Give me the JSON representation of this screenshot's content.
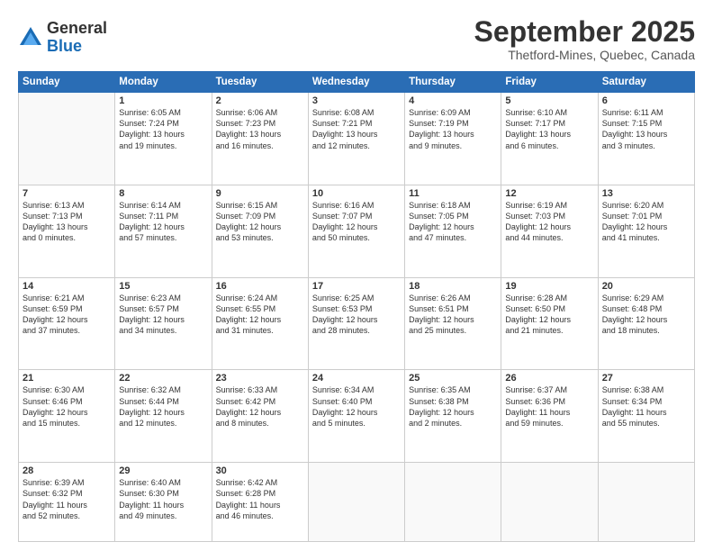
{
  "logo": {
    "general": "General",
    "blue": "Blue"
  },
  "header": {
    "month": "September 2025",
    "location": "Thetford-Mines, Quebec, Canada"
  },
  "weekdays": [
    "Sunday",
    "Monday",
    "Tuesday",
    "Wednesday",
    "Thursday",
    "Friday",
    "Saturday"
  ],
  "weeks": [
    [
      {
        "day": "",
        "info": ""
      },
      {
        "day": "1",
        "info": "Sunrise: 6:05 AM\nSunset: 7:24 PM\nDaylight: 13 hours\nand 19 minutes."
      },
      {
        "day": "2",
        "info": "Sunrise: 6:06 AM\nSunset: 7:23 PM\nDaylight: 13 hours\nand 16 minutes."
      },
      {
        "day": "3",
        "info": "Sunrise: 6:08 AM\nSunset: 7:21 PM\nDaylight: 13 hours\nand 12 minutes."
      },
      {
        "day": "4",
        "info": "Sunrise: 6:09 AM\nSunset: 7:19 PM\nDaylight: 13 hours\nand 9 minutes."
      },
      {
        "day": "5",
        "info": "Sunrise: 6:10 AM\nSunset: 7:17 PM\nDaylight: 13 hours\nand 6 minutes."
      },
      {
        "day": "6",
        "info": "Sunrise: 6:11 AM\nSunset: 7:15 PM\nDaylight: 13 hours\nand 3 minutes."
      }
    ],
    [
      {
        "day": "7",
        "info": "Sunrise: 6:13 AM\nSunset: 7:13 PM\nDaylight: 13 hours\nand 0 minutes."
      },
      {
        "day": "8",
        "info": "Sunrise: 6:14 AM\nSunset: 7:11 PM\nDaylight: 12 hours\nand 57 minutes."
      },
      {
        "day": "9",
        "info": "Sunrise: 6:15 AM\nSunset: 7:09 PM\nDaylight: 12 hours\nand 53 minutes."
      },
      {
        "day": "10",
        "info": "Sunrise: 6:16 AM\nSunset: 7:07 PM\nDaylight: 12 hours\nand 50 minutes."
      },
      {
        "day": "11",
        "info": "Sunrise: 6:18 AM\nSunset: 7:05 PM\nDaylight: 12 hours\nand 47 minutes."
      },
      {
        "day": "12",
        "info": "Sunrise: 6:19 AM\nSunset: 7:03 PM\nDaylight: 12 hours\nand 44 minutes."
      },
      {
        "day": "13",
        "info": "Sunrise: 6:20 AM\nSunset: 7:01 PM\nDaylight: 12 hours\nand 41 minutes."
      }
    ],
    [
      {
        "day": "14",
        "info": "Sunrise: 6:21 AM\nSunset: 6:59 PM\nDaylight: 12 hours\nand 37 minutes."
      },
      {
        "day": "15",
        "info": "Sunrise: 6:23 AM\nSunset: 6:57 PM\nDaylight: 12 hours\nand 34 minutes."
      },
      {
        "day": "16",
        "info": "Sunrise: 6:24 AM\nSunset: 6:55 PM\nDaylight: 12 hours\nand 31 minutes."
      },
      {
        "day": "17",
        "info": "Sunrise: 6:25 AM\nSunset: 6:53 PM\nDaylight: 12 hours\nand 28 minutes."
      },
      {
        "day": "18",
        "info": "Sunrise: 6:26 AM\nSunset: 6:51 PM\nDaylight: 12 hours\nand 25 minutes."
      },
      {
        "day": "19",
        "info": "Sunrise: 6:28 AM\nSunset: 6:50 PM\nDaylight: 12 hours\nand 21 minutes."
      },
      {
        "day": "20",
        "info": "Sunrise: 6:29 AM\nSunset: 6:48 PM\nDaylight: 12 hours\nand 18 minutes."
      }
    ],
    [
      {
        "day": "21",
        "info": "Sunrise: 6:30 AM\nSunset: 6:46 PM\nDaylight: 12 hours\nand 15 minutes."
      },
      {
        "day": "22",
        "info": "Sunrise: 6:32 AM\nSunset: 6:44 PM\nDaylight: 12 hours\nand 12 minutes."
      },
      {
        "day": "23",
        "info": "Sunrise: 6:33 AM\nSunset: 6:42 PM\nDaylight: 12 hours\nand 8 minutes."
      },
      {
        "day": "24",
        "info": "Sunrise: 6:34 AM\nSunset: 6:40 PM\nDaylight: 12 hours\nand 5 minutes."
      },
      {
        "day": "25",
        "info": "Sunrise: 6:35 AM\nSunset: 6:38 PM\nDaylight: 12 hours\nand 2 minutes."
      },
      {
        "day": "26",
        "info": "Sunrise: 6:37 AM\nSunset: 6:36 PM\nDaylight: 11 hours\nand 59 minutes."
      },
      {
        "day": "27",
        "info": "Sunrise: 6:38 AM\nSunset: 6:34 PM\nDaylight: 11 hours\nand 55 minutes."
      }
    ],
    [
      {
        "day": "28",
        "info": "Sunrise: 6:39 AM\nSunset: 6:32 PM\nDaylight: 11 hours\nand 52 minutes."
      },
      {
        "day": "29",
        "info": "Sunrise: 6:40 AM\nSunset: 6:30 PM\nDaylight: 11 hours\nand 49 minutes."
      },
      {
        "day": "30",
        "info": "Sunrise: 6:42 AM\nSunset: 6:28 PM\nDaylight: 11 hours\nand 46 minutes."
      },
      {
        "day": "",
        "info": ""
      },
      {
        "day": "",
        "info": ""
      },
      {
        "day": "",
        "info": ""
      },
      {
        "day": "",
        "info": ""
      }
    ]
  ]
}
